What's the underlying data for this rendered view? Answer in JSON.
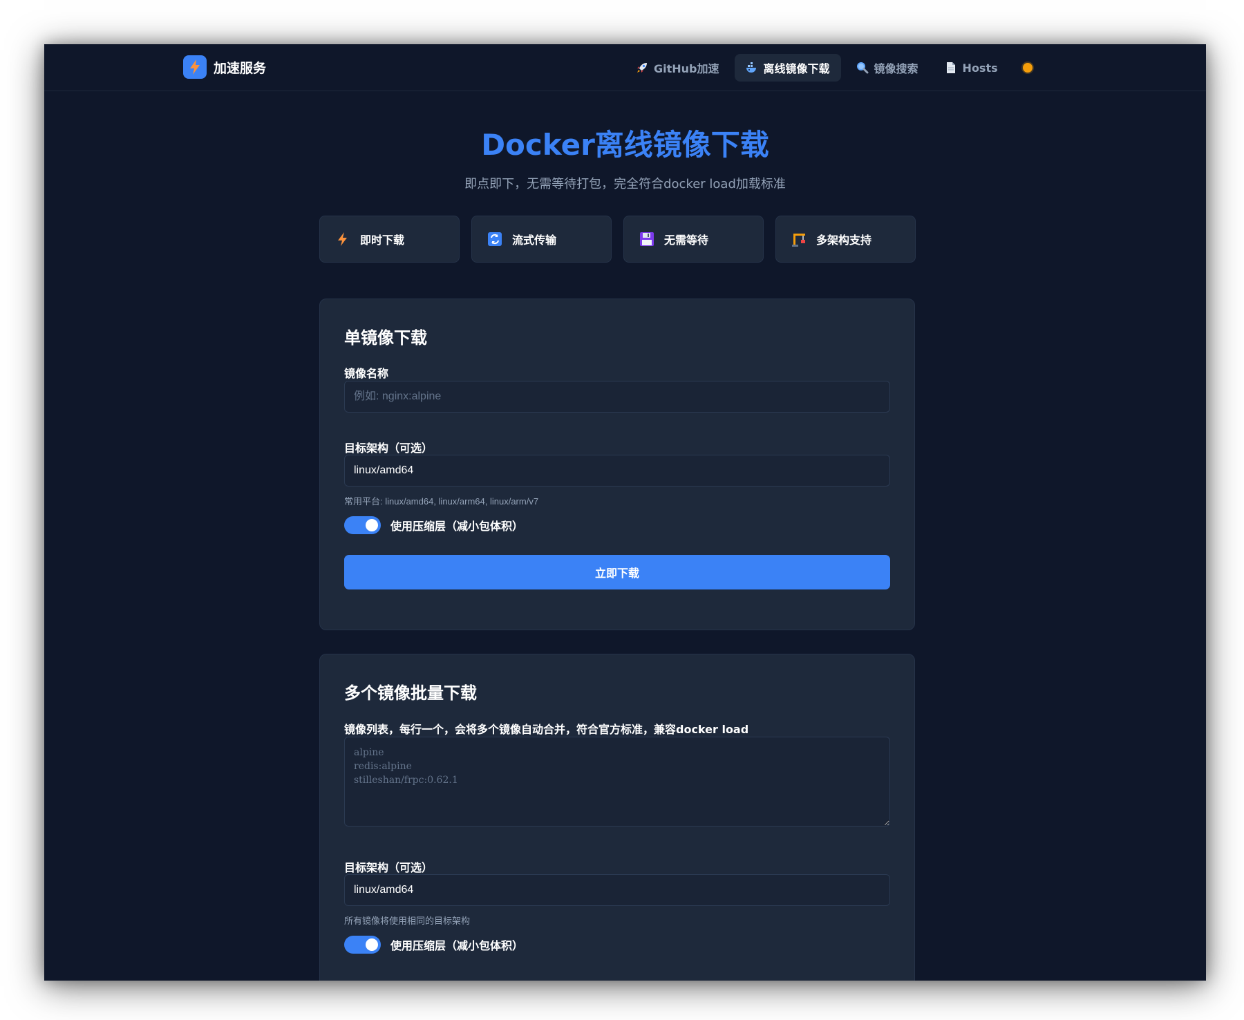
{
  "nav": {
    "brand": "加速服务",
    "links": [
      {
        "label": "GitHub加速",
        "icon": "rocket-icon",
        "active": false
      },
      {
        "label": "离线镜像下载",
        "icon": "whale-icon",
        "active": true
      },
      {
        "label": "镜像搜索",
        "icon": "magnifier-icon",
        "active": false
      },
      {
        "label": "Hosts",
        "icon": "document-icon",
        "active": false
      }
    ],
    "theme_icon": "sun-icon"
  },
  "hero": {
    "title": "Docker离线镜像下载",
    "subtitle": "即点即下，无需等待打包，完全符合docker load加载标准"
  },
  "features": [
    {
      "label": "即时下载",
      "icon": "lightning-icon"
    },
    {
      "label": "流式传输",
      "icon": "sync-icon"
    },
    {
      "label": "无需等待",
      "icon": "floppy-disk-icon"
    },
    {
      "label": "多架构支持",
      "icon": "crane-icon"
    }
  ],
  "single": {
    "title": "单镜像下载",
    "name_label": "镜像名称",
    "name_placeholder": "例如: nginx:alpine",
    "name_value": "",
    "arch_label": "目标架构（可选）",
    "arch_value": "linux/amd64",
    "arch_hint": "常用平台: linux/amd64, linux/arm64, linux/arm/v7",
    "compress_label": "使用压缩层（减小包体积）",
    "compress_on": true,
    "button": "立即下载"
  },
  "batch": {
    "title": "多个镜像批量下载",
    "list_label": "镜像列表，每行一个，会将多个镜像自动合并，符合官方标准，兼容docker load",
    "list_placeholder": "alpine\nredis:alpine\nstilleshan/frpc:0.62.1",
    "arch_label": "目标架构（可选）",
    "arch_value": "linux/amd64",
    "arch_hint": "所有镜像将使用相同的目标架构",
    "compress_label": "使用压缩层（减小包体积）",
    "compress_on": true
  },
  "colors": {
    "background": "#0f172a",
    "card": "#1e293b",
    "accent": "#3b82f6",
    "muted": "#94a3b8",
    "sun": "#f59e0b"
  }
}
